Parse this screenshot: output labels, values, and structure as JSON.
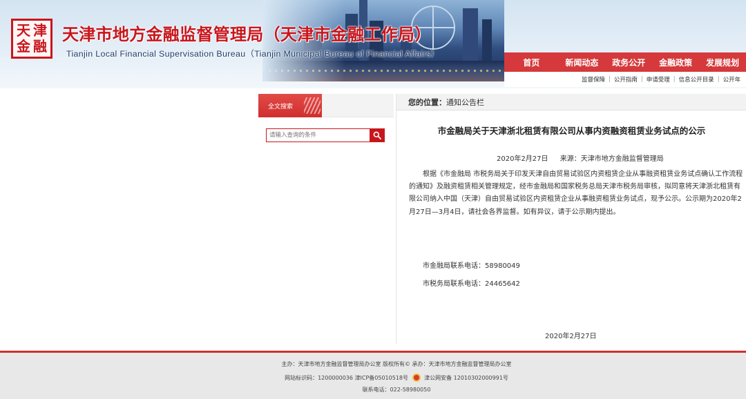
{
  "header": {
    "seal_text": [
      "天",
      "津",
      "金",
      "融"
    ],
    "title": "天津市地方金融监督管理局（天津市金融工作局）",
    "subtitle": "Tianjin Local Financial Supervisation Bureau（Tianjin Municipal Bureau of Financial Affairs）"
  },
  "nav": {
    "items": [
      "首页",
      "新闻动态",
      "政务公开",
      "金融政策",
      "发展规划"
    ]
  },
  "subnav": {
    "items": [
      "监督保障",
      "公开指南",
      "申请受理",
      "信息公开目录",
      "公开年"
    ]
  },
  "sidebar": {
    "search_tab": "全文搜索",
    "search_placeholder": "请输入查询的条件"
  },
  "breadcrumb": {
    "label": "您的位置：",
    "value": "通知公告栏"
  },
  "article": {
    "title": "市金融局关于天津浙北租赁有限公司从事内资融资租赁业务试点的公示",
    "date": "2020年2月27日",
    "source": "来源：天津市地方金融监督管理局",
    "body": "根据《市金融局 市税务局关于印发天津自由贸易试验区内资租赁企业从事融资租赁业务试点确认工作流程的通知》及融资租赁相关管理规定，经市金融局和国家税务总局天津市税务局审核，拟同意将天津浙北租赁有限公司纳入中国（天津）自由贸易试验区内资租赁企业从事融资租赁业务试点，现予公示。公示期为2020年2月27日—3月4日，请社会各界监督。如有异议，请于公示期内提出。",
    "contact1": "市金融局联系电话：58980049",
    "contact2": "市税务局联系电话：24465642",
    "sign_date": "2020年2月27日"
  },
  "footer": {
    "line1": "主办：天津市地方金融监督管理局办公室 版权所有© 承办：天津市地方金融监督管理局办公室",
    "line2_a": "网站标识码：1200000036 津ICP备05010518号",
    "line2_b": "津公网安备 12010302000991号",
    "line3": "联系电话：022-58980050"
  },
  "colors": {
    "brand_red": "#c8161d",
    "nav_red": "#d5393b"
  }
}
